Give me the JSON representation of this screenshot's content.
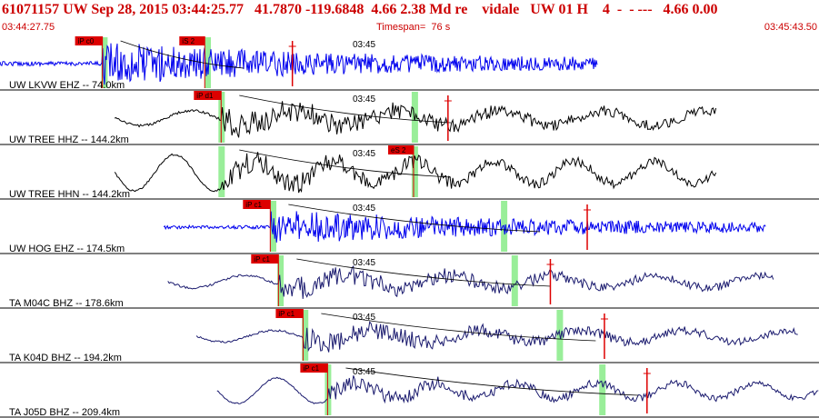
{
  "header": {
    "title": "61071157 UW Sep 28, 2015 03:44:25.77   41.7870 -119.6848  4.66 2.38 Md re    vidale   UW 01 H    4  -  - ---   4.66 0.00",
    "start_time": "03:44:27.75",
    "timespan": "Timespan=  76 s",
    "end_time": "03:45:43.50"
  },
  "colors": {
    "header_text": "#cc0000",
    "trace_blue": "#0000ee",
    "trace_black": "#000000",
    "trace_navy": "#1a1a6e",
    "pick_red": "#dd0000",
    "phase_green": "#99ee99",
    "divider": "#000000"
  },
  "minute_marker": "03:45",
  "channels": [
    {
      "label": "UW LKVW EHZ -- 74.0km",
      "color": "blue",
      "style": "hf",
      "start": 0.0,
      "end": 0.73,
      "onset": 0.125,
      "p_pick": "iP c0",
      "p_x": 0.125,
      "s_pick": "iS 2",
      "s_x": 0.25,
      "green": [
        0.127,
        0.253
      ],
      "red_marks": [
        0.357
      ],
      "amp": 0.75
    },
    {
      "label": "UW TREE HHZ -- 144.2km",
      "color": "black",
      "style": "mixed",
      "start": 0.14,
      "end": 0.875,
      "onset": 0.27,
      "p_pick": "iP d1",
      "p_x": 0.27,
      "s_pick": "",
      "s_x": 0,
      "green": [
        0.27,
        0.506
      ],
      "red_marks": [
        0.547
      ],
      "amp": 0.7
    },
    {
      "label": "UW TREE HHN -- 144.2km",
      "color": "black",
      "style": "lf",
      "start": 0.14,
      "end": 0.875,
      "onset": 0.27,
      "p_pick": "",
      "p_x": 0,
      "s_pick": "eS 2",
      "s_x": 0.505,
      "green": [
        0.27,
        0.506
      ],
      "red_marks": [],
      "amp": 0.85
    },
    {
      "label": "UW HOG EHZ -- 174.5km",
      "color": "blue",
      "style": "hf",
      "start": 0.2,
      "end": 0.935,
      "onset": 0.33,
      "p_pick": "iP c1",
      "p_x": 0.33,
      "s_pick": "",
      "s_x": 0,
      "green": [
        0.333,
        0.615
      ],
      "red_marks": [
        0.717
      ],
      "amp": 0.6
    },
    {
      "label": "TA M04C BHZ -- 178.6km",
      "color": "navy",
      "style": "mixed",
      "start": 0.205,
      "end": 0.945,
      "onset": 0.34,
      "p_pick": "iP c1",
      "p_x": 0.34,
      "s_pick": "",
      "s_x": 0,
      "green": [
        0.342,
        0.628
      ],
      "red_marks": [
        0.672
      ],
      "amp": 0.6
    },
    {
      "label": "TA K04D BHZ -- 194.2km",
      "color": "navy",
      "style": "mixed",
      "start": 0.24,
      "end": 0.975,
      "onset": 0.37,
      "p_pick": "iP c1",
      "p_x": 0.37,
      "s_pick": "",
      "s_x": 0,
      "green": [
        0.372,
        0.683
      ],
      "red_marks": [
        0.738
      ],
      "amp": 0.55
    },
    {
      "label": "TA J05D BHZ -- 209.4km",
      "color": "navy",
      "style": "lf",
      "start": 0.265,
      "end": 1.0,
      "onset": 0.4,
      "p_pick": "iP c1",
      "p_x": 0.4,
      "s_pick": "",
      "s_x": 0,
      "green": [
        0.4,
        0.735
      ],
      "red_marks": [
        0.79
      ],
      "amp": 0.6
    }
  ]
}
